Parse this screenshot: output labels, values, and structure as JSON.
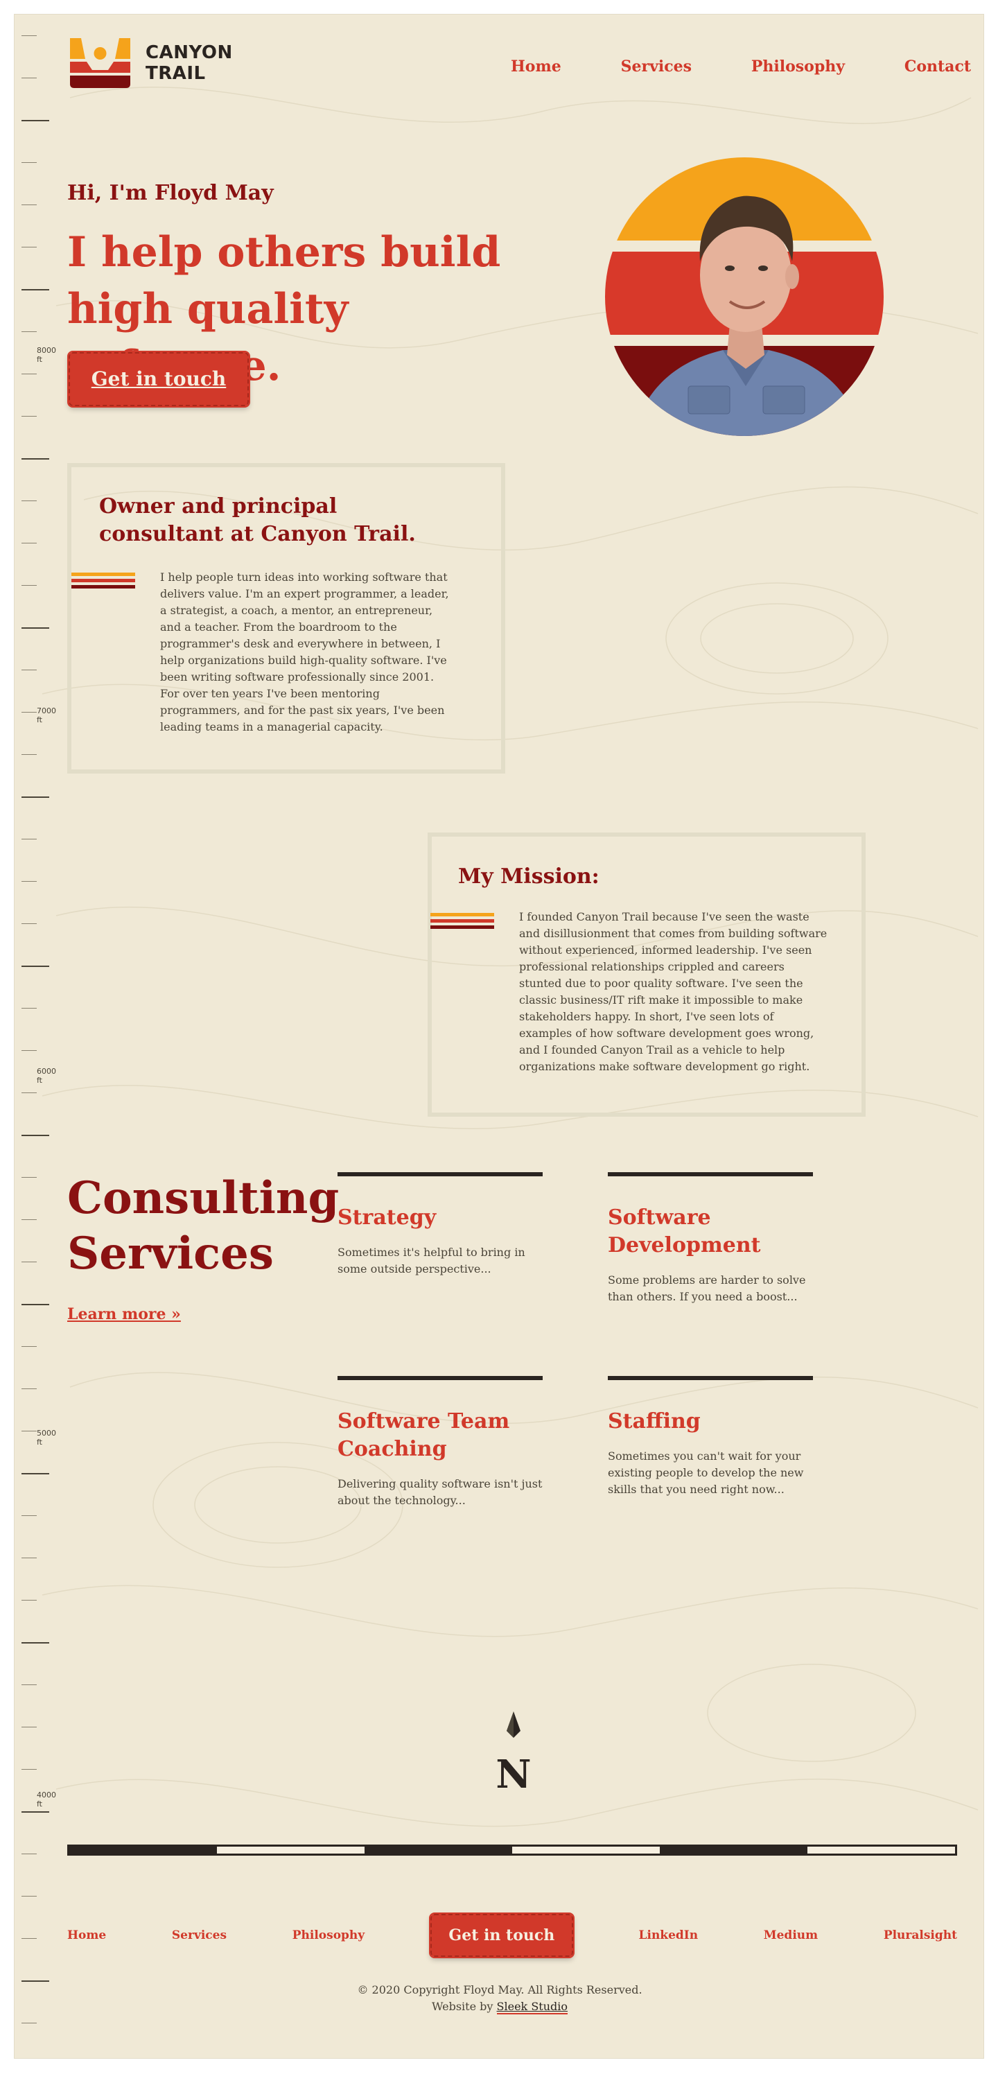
{
  "brand": {
    "name_line1": "CANYON",
    "name_line2": "TRAIL"
  },
  "nav": {
    "home": "Home",
    "services": "Services",
    "philosophy": "Philosophy",
    "contact": "Contact"
  },
  "hero": {
    "greeting": "Hi, I'm Floyd May",
    "headline": "I help others build high quality software.",
    "cta": "Get in touch"
  },
  "elevations": [
    "8000 ft",
    "7000 ft",
    "6000 ft",
    "5000 ft",
    "4000 ft"
  ],
  "about": {
    "title": "Owner and principal consultant at Canyon Trail.",
    "body": "I help people turn ideas into working software that delivers value. I'm an expert programmer, a leader, a strategist, a coach, a mentor, an entrepreneur, and a teacher. From the boardroom to the programmer's desk and everywhere in between, I help organizations build high-quality software. I've been writing software professionally since 2001. For over ten years I've been mentoring programmers, and for the past six years, I've been leading teams in a managerial capacity."
  },
  "mission": {
    "title": "My Mission:",
    "body": "I founded Canyon Trail because I've seen the waste and disillusionment that comes from building software without experienced, informed leadership. I've seen professional relationships crippled and careers stunted due to poor quality software. I've seen the classic business/IT rift make it impossible to make stakeholders happy. In short, I've seen lots of examples of how software development goes wrong, and I founded Canyon Trail as a vehicle to help organizations make software development go right."
  },
  "services": {
    "title": "Consulting Services",
    "learn_more": "Learn more »",
    "items": [
      {
        "title": "Strategy",
        "desc": "Sometimes it's helpful to bring in some outside perspective..."
      },
      {
        "title": "Software Development",
        "desc": "Some problems are harder to solve than others. If you need a boost..."
      },
      {
        "title": "Software Team Coaching",
        "desc": "Delivering quality software isn't just about the technology..."
      },
      {
        "title": "Staffing",
        "desc": "Sometimes you can't wait for your existing people to develop the new skills that you need right now..."
      }
    ]
  },
  "compass": {
    "letter": "N"
  },
  "footer": {
    "links": {
      "home": "Home",
      "services": "Services",
      "philosophy": "Philosophy",
      "cta": "Get in touch",
      "linkedin": "LinkedIn",
      "medium": "Medium",
      "pluralsight": "Pluralsight"
    },
    "copyright": "© 2020 Copyright Floyd May. All Rights Reserved.",
    "credit_prefix": "Website by",
    "credit_name": "Sleek Studio"
  },
  "colors": {
    "background": "#f0e9d6",
    "accent": "#d1392a",
    "dark_red": "#8a1212",
    "orange": "#f5a31b",
    "maroon": "#7a0e0e"
  }
}
